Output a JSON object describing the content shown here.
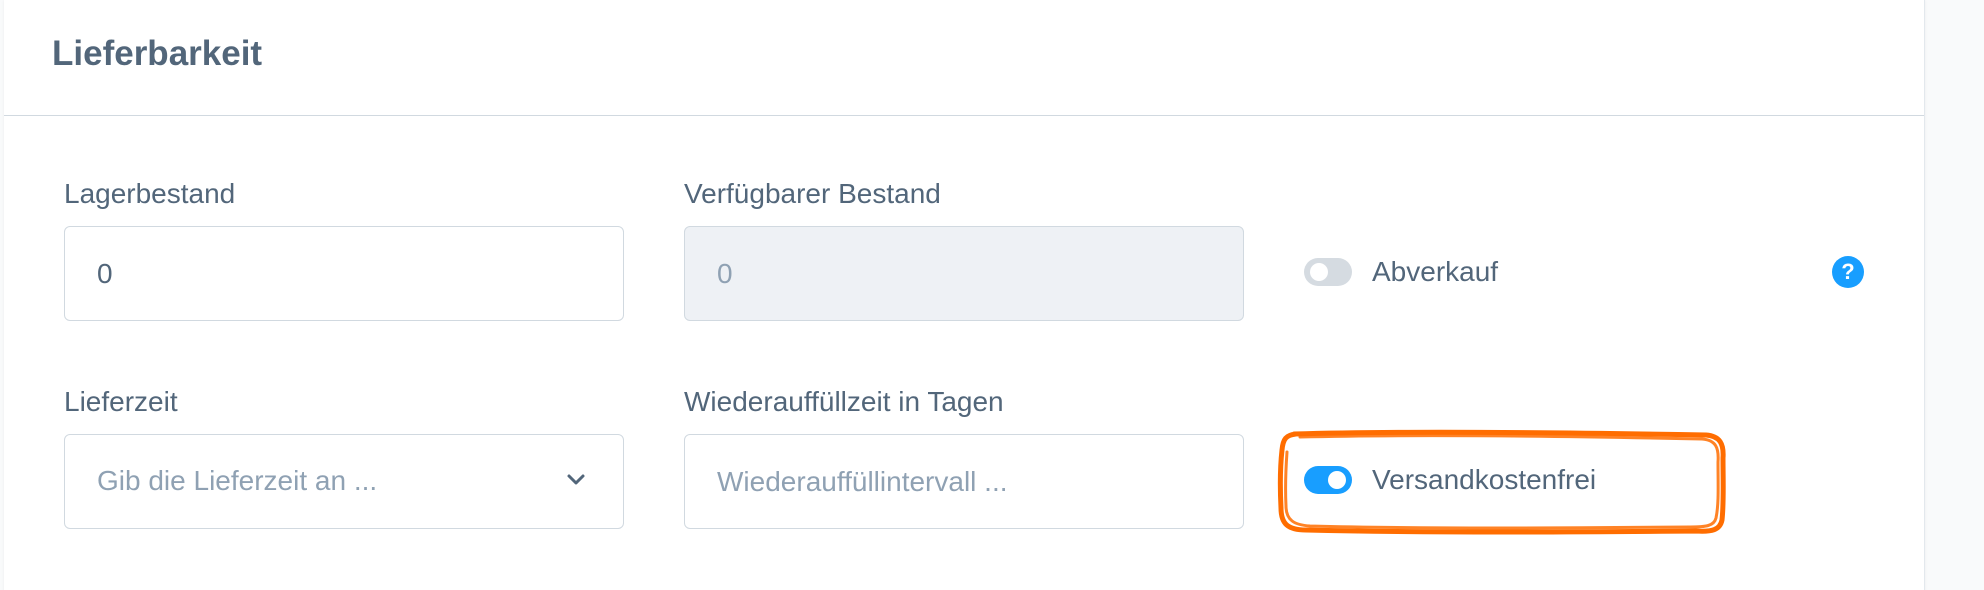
{
  "card": {
    "title": "Lieferbarkeit"
  },
  "fields": {
    "stock": {
      "label": "Lagerbestand",
      "value": "0"
    },
    "available_stock": {
      "label": "Verfügbarer Bestand",
      "value": "0"
    },
    "clearance": {
      "label": "Abverkauf",
      "checked": false
    },
    "delivery_time": {
      "label": "Lieferzeit",
      "placeholder": "Gib die Lieferzeit an ..."
    },
    "restock_time": {
      "label": "Wiederauffüllzeit in Tagen",
      "placeholder": "Wiederauffüllintervall ..."
    },
    "free_shipping": {
      "label": "Versandkostenfrei",
      "checked": true
    }
  },
  "help": {
    "glyph": "?"
  },
  "colors": {
    "accent": "#189eff",
    "highlight": "#ff6d00",
    "text": "#52667a",
    "placeholder": "#8fa1b3",
    "border": "#d1d9e0",
    "disabled_bg": "#eef1f5"
  },
  "icons": {
    "select_chevron": "chevron-down-icon",
    "help": "question-circle-icon"
  }
}
